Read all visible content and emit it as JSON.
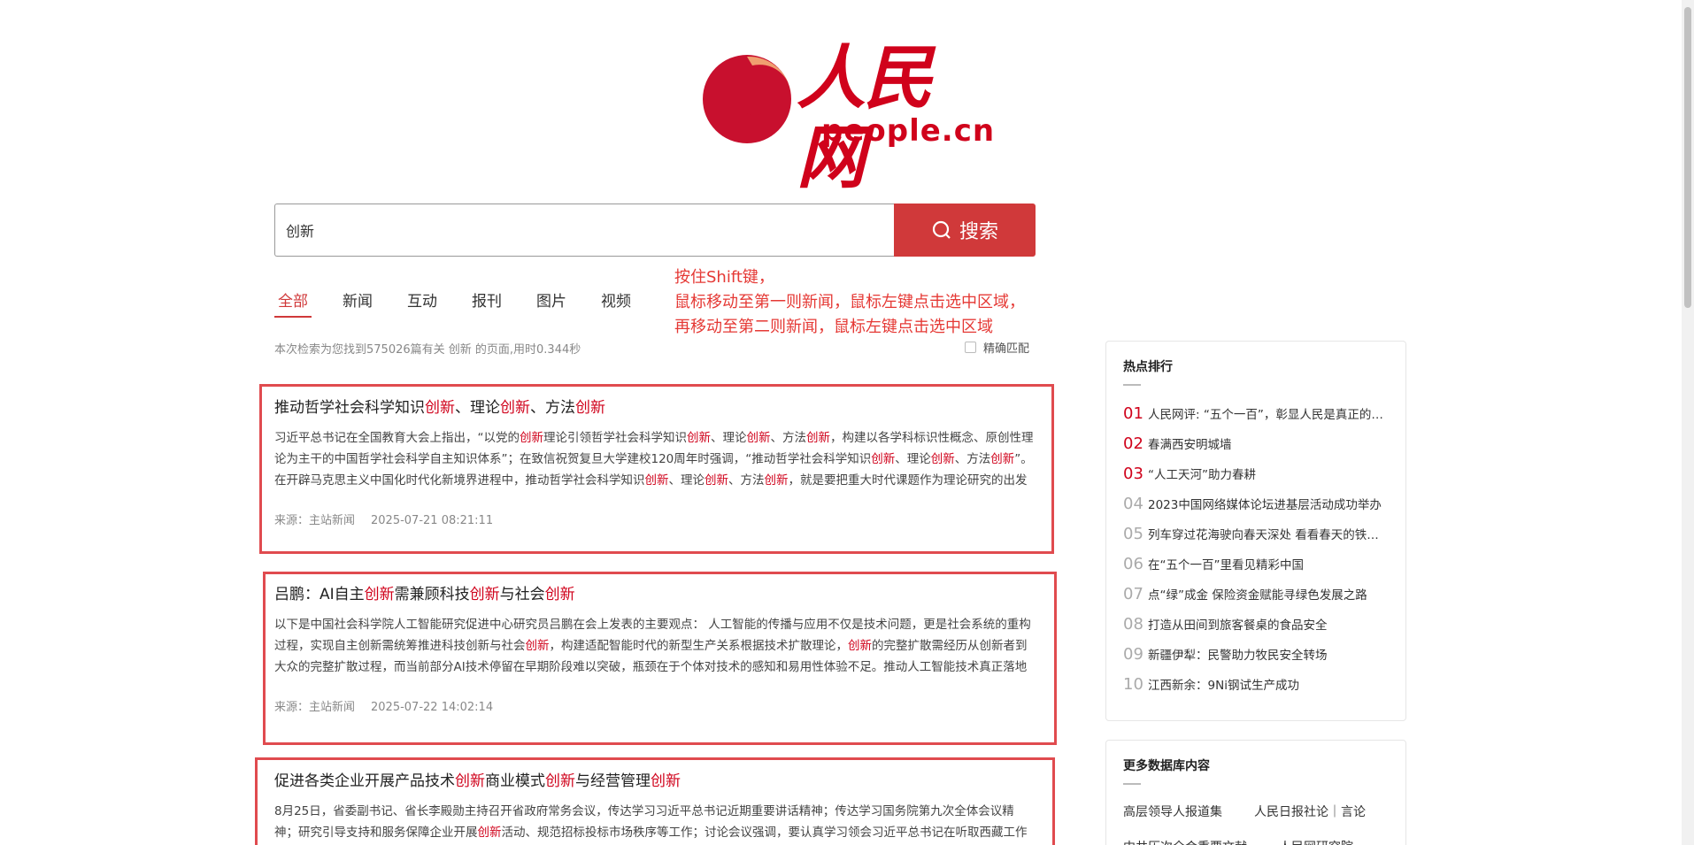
{
  "logo": {
    "cn": "人民网",
    "en": "people.cn"
  },
  "search": {
    "value": "创新",
    "button_label": "搜索"
  },
  "tabs": [
    "全部",
    "新闻",
    "互动",
    "报刊",
    "图片",
    "视频"
  ],
  "instruction": [
    "按住Shift键，",
    "鼠标移动至第一则新闻，鼠标左键点击选中区域，",
    "再移动至第二则新闻，鼠标左键点击选中区域"
  ],
  "summary": "本次检索为您找到575026篇有关 创新 的页面,用时0.344秒",
  "exact_match_label": "精确匹配",
  "results": [
    {
      "title": [
        "推动哲学社会科学知识",
        "创新",
        "、理论",
        "创新",
        "、方法",
        "创新"
      ],
      "snippet": [
        "习近平总书记在全国教育大会上指出，“以党的",
        "创新",
        "理论引领哲学社会科学知识",
        "创新",
        "、理论",
        "创新",
        "、方法",
        "创新",
        "，构建以各学科标识性概念、原创性理论为主干的中国哲学社会科学自主知识体系”；在致信祝贺复旦大学建校120周年时强调，“推动哲学社会科学知识",
        "创新",
        "、理论",
        "创新",
        "、方法",
        "创新",
        "”。在开辟马克思主义中国化时代化新境界进程中，推动哲学社会科学知识",
        "创新",
        "、理论",
        "创新",
        "、方法",
        "创新",
        "，就是要把重大时代课题作为理论研究的出发点和落脚点"
      ],
      "source": "来源：主站新闻",
      "time": "2025-07-21 08:21:11"
    },
    {
      "title": [
        "吕鹏：AI自主",
        "创新",
        "需兼顾科技",
        "创新",
        "与社会",
        "创新"
      ],
      "snippet": [
        "以下是中国社会科学院人工智能研究促进中心研究员吕鹏在会上发表的主要观点： 人工智能的传播与应用不仅是技术问题，更是社会系统的重构过程，实现自主创新需统筹推进科技创新与社会",
        "创新",
        "，构建适配智能时代的新型生产关系根据技术扩散理论，",
        "创新",
        "的完整扩散需经历从创新者到大众的完整扩散过程，而当前部分AI技术停留在早期阶段难以突破，瓶颈在于个体对技术的感知和易用性体验不足。推动人工智能技术真正落地需要"
      ],
      "source": "来源：主站新闻",
      "time": "2025-07-22 14:02:14"
    },
    {
      "title": [
        "促进各类企业开展产品技术",
        "创新",
        "商业模式",
        "创新",
        "与经营管理",
        "创新"
      ],
      "snippet": [
        "8月25日，省委副书记、省长李殿勋主持召开省政府常务会议，传达学习习近平总书记近期重要讲话精神；传达学习国务院第九次全体会议精神；研究引导支持和服务保障企业开展",
        "创新",
        "活动、规范招标投标市场秩序等工作；讨论会议强调，要认真学习领会习近平总书记在听取西藏工作汇报时的重要讲话精神"
      ],
      "source": "",
      "time": ""
    }
  ],
  "hot": {
    "title": "热点排行",
    "items": [
      {
        "num": "01",
        "text": "人民网评: “五个一百”，彰显人民是真正的英雄"
      },
      {
        "num": "02",
        "text": "春满西安明城墙"
      },
      {
        "num": "03",
        "text": "“人工天河”助力春耕"
      },
      {
        "num": "04",
        "text": "2023中国网络媒体论坛进基层活动成功举办"
      },
      {
        "num": "05",
        "text": "列车穿过花海驶向春天深处 看看春天的铁路风景"
      },
      {
        "num": "06",
        "text": "在“五个一百”里看见精彩中国"
      },
      {
        "num": "07",
        "text": "点“绿”成金 保险资金赋能寻绿色发展之路"
      },
      {
        "num": "08",
        "text": "打造从田间到旅客餐桌的食品安全"
      },
      {
        "num": "09",
        "text": "新疆伊犁：民警助力牧民安全转场"
      },
      {
        "num": "10",
        "text": "江西新余：9Ni钢试生产成功"
      }
    ]
  },
  "more_db": {
    "title": "更多数据库内容",
    "links": [
      "高层领导人报道集",
      "人民日报社论｜言论"
    ],
    "links2": [
      "中共历次全会重要文献",
      "人民网研究院"
    ]
  },
  "colors": {
    "accent": "#d0021b",
    "button": "#d0393a",
    "highlight_box": "#e04b4f"
  }
}
